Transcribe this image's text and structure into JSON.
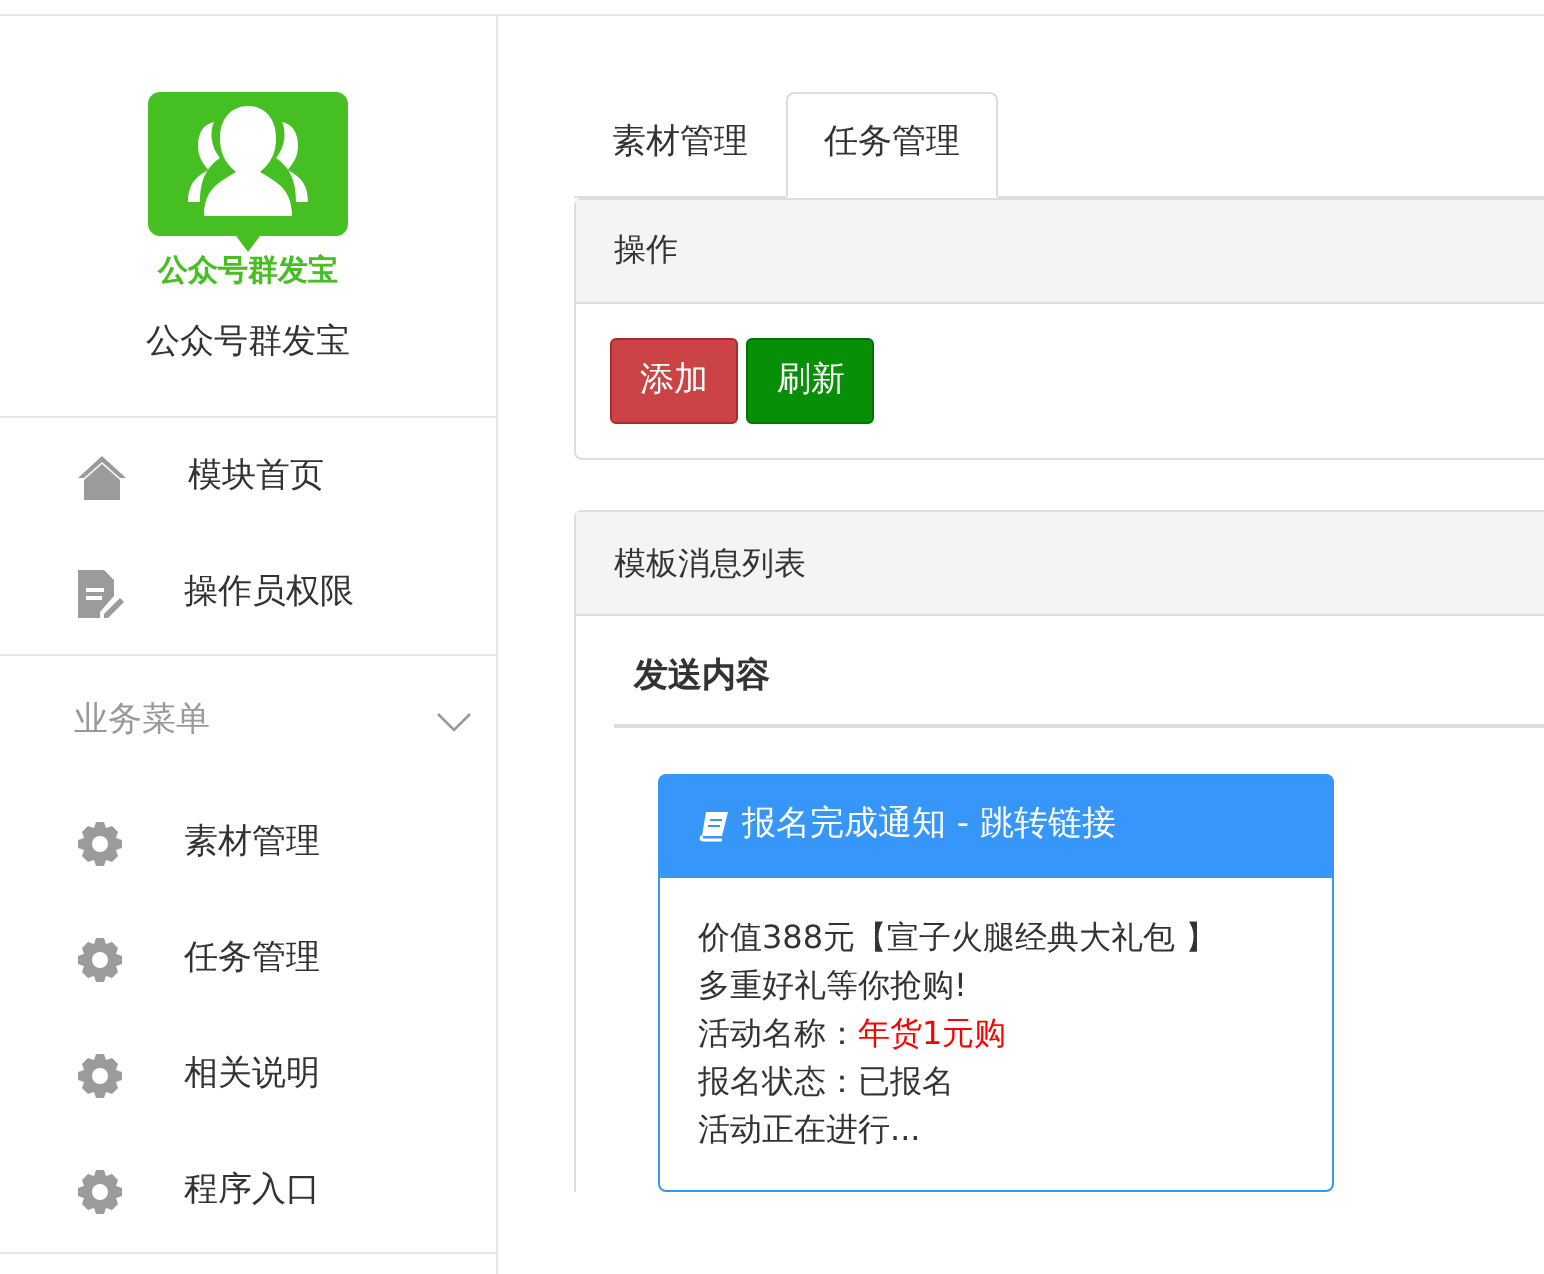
{
  "sidebar": {
    "logo_text": "公众号群发宝",
    "app_name": "公众号群发宝",
    "top_items": [
      {
        "kind": "home",
        "label": "模块首页"
      },
      {
        "kind": "document",
        "label": "操作员权限"
      }
    ],
    "section": {
      "title": "业务菜单",
      "expanded": true,
      "items": [
        {
          "label": "素材管理"
        },
        {
          "label": "任务管理"
        },
        {
          "label": "相关说明"
        },
        {
          "label": "程序入口"
        }
      ]
    }
  },
  "tabs": [
    {
      "label": "素材管理",
      "selected": false
    },
    {
      "label": "任务管理",
      "selected": true
    }
  ],
  "actions_panel": {
    "title": "操作",
    "buttons": [
      {
        "label": "添加",
        "kind": "danger"
      },
      {
        "label": "刷新",
        "kind": "success"
      }
    ]
  },
  "list_panel": {
    "title": "模板消息列表",
    "column": "发送内容",
    "message": {
      "title": "报名完成通知 - 跳转链接",
      "lines": [
        {
          "kind": "text",
          "text": "价值388元【宣子火腿经典大礼包 】"
        },
        {
          "kind": "text",
          "text": "多重好礼等你抢购!"
        },
        {
          "kind": "field",
          "label": "活动名称：",
          "value": "年货1元购",
          "highlight": true
        },
        {
          "kind": "field",
          "label": "报名状态：",
          "value": "已报名",
          "highlight": false
        },
        {
          "kind": "text",
          "text": "活动正在进行..."
        }
      ]
    }
  }
}
